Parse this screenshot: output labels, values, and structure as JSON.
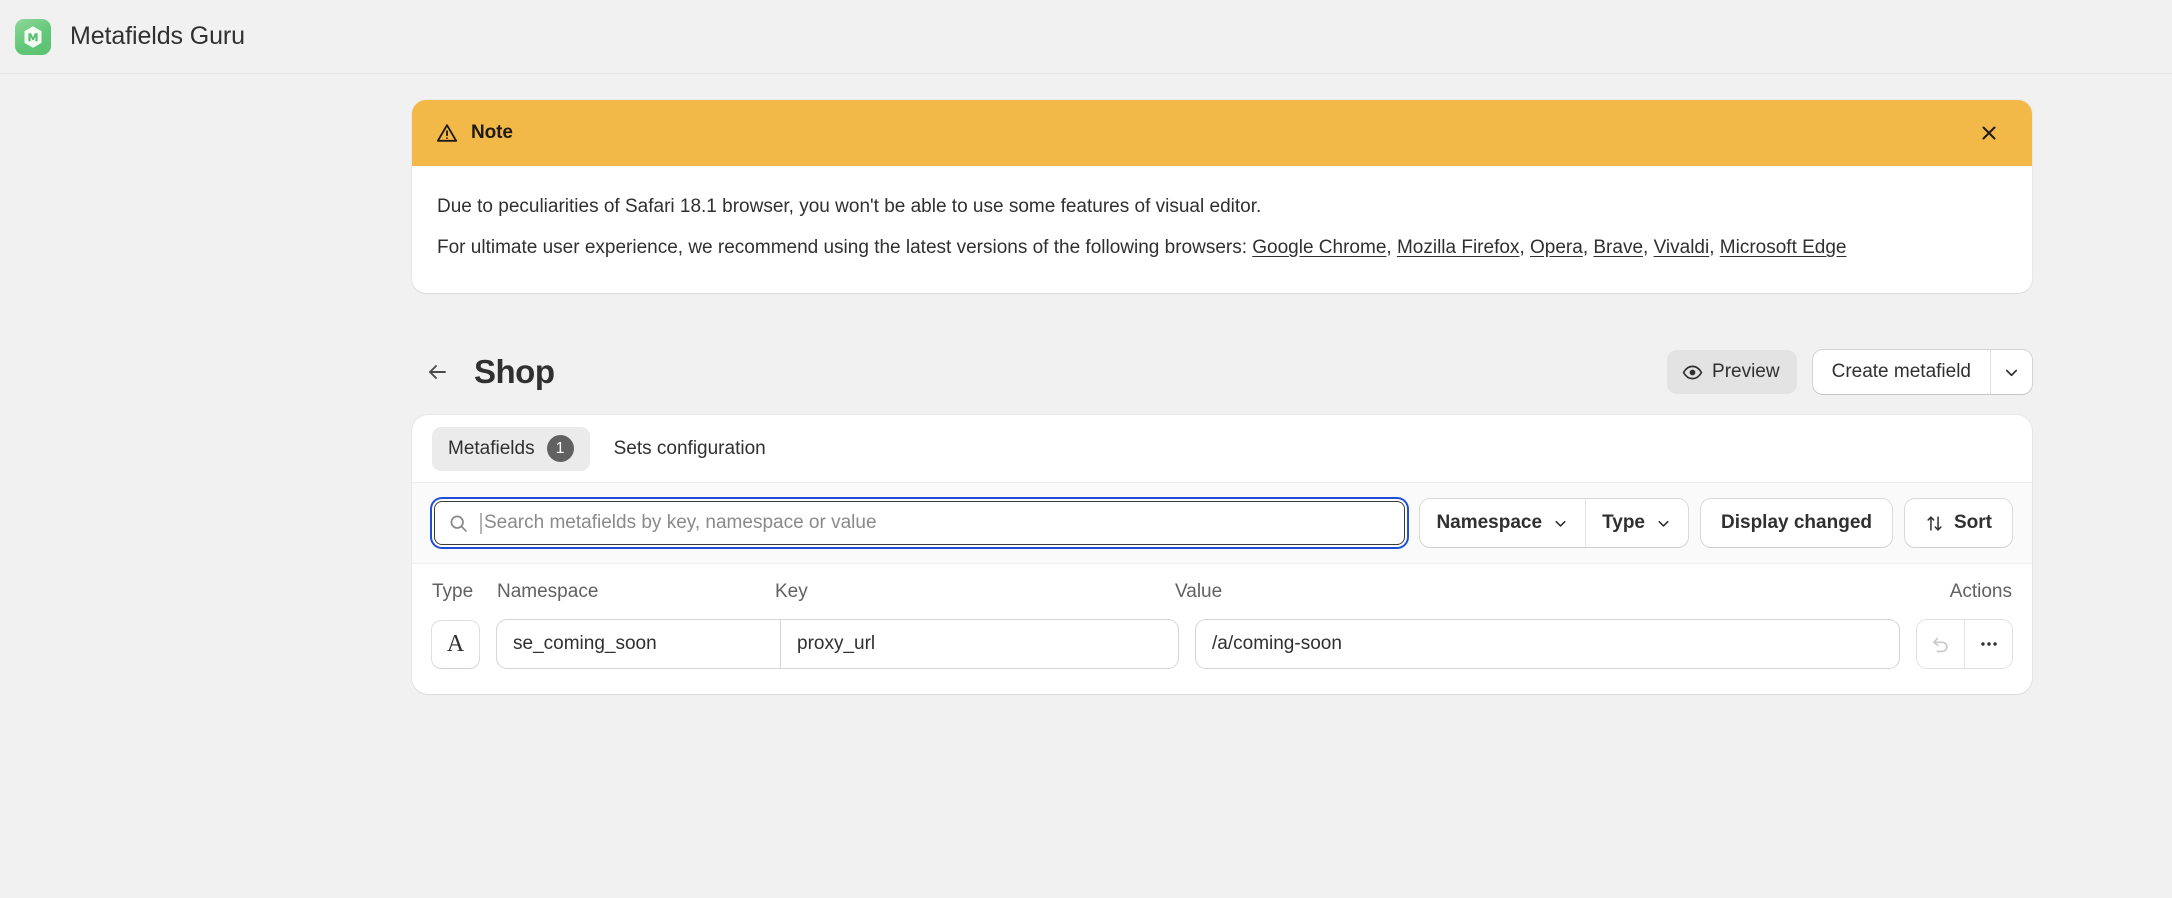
{
  "appbar": {
    "logo_icon": "metafields-guru-logo",
    "title": "Metafields Guru"
  },
  "banner": {
    "icon": "warning-triangle-icon",
    "title": "Note",
    "close_icon": "close-icon",
    "accent_color": "#f2b949",
    "line1": "Due to peculiarities of Safari 18.1 browser, you won't be able to use some features of visual editor.",
    "line2_prefix": "For ultimate user experience, we recommend using the latest versions of the following browsers: ",
    "links": [
      {
        "label": "Google Chrome",
        "sep": ", "
      },
      {
        "label": "Mozilla Firefox",
        "sep": ", "
      },
      {
        "label": "Opera",
        "sep": ", "
      },
      {
        "label": "Brave",
        "sep": ", "
      },
      {
        "label": "Vivaldi",
        "sep": ", "
      },
      {
        "label": "Microsoft Edge",
        "sep": ""
      }
    ]
  },
  "page_header": {
    "back_icon": "arrow-left-icon",
    "title": "Shop",
    "preview_label": "Preview",
    "preview_icon": "eye-icon",
    "create_label": "Create metafield",
    "create_caret_icon": "chevron-down-icon"
  },
  "tabs": [
    {
      "label": "Metafields",
      "badge": "1",
      "active": true
    },
    {
      "label": "Sets configuration",
      "badge": "",
      "active": false
    }
  ],
  "filters": {
    "search": {
      "placeholder": "Search metafields by key, namespace or value",
      "value": "",
      "icon": "search-icon",
      "focused": true,
      "focus_color": "#1f4fd8"
    },
    "namespace_label": "Namespace",
    "namespace_icon": "chevron-down-icon",
    "type_label": "Type",
    "type_icon": "chevron-down-icon",
    "display_changed_label": "Display changed",
    "sort_label": "Sort",
    "sort_icon": "sort-arrows-icon"
  },
  "table": {
    "headers": {
      "type": "Type",
      "namespace": "Namespace",
      "key": "Key",
      "value": "Value",
      "actions": "Actions"
    },
    "rows": [
      {
        "type_glyph": "A",
        "type_name": "single-line-text-type",
        "namespace": "se_coming_soon",
        "key": "proxy_url",
        "value": "/a/coming-soon",
        "revert_icon": "revert-icon",
        "revert_disabled": true,
        "more_icon": "more-horizontal-icon"
      }
    ]
  }
}
